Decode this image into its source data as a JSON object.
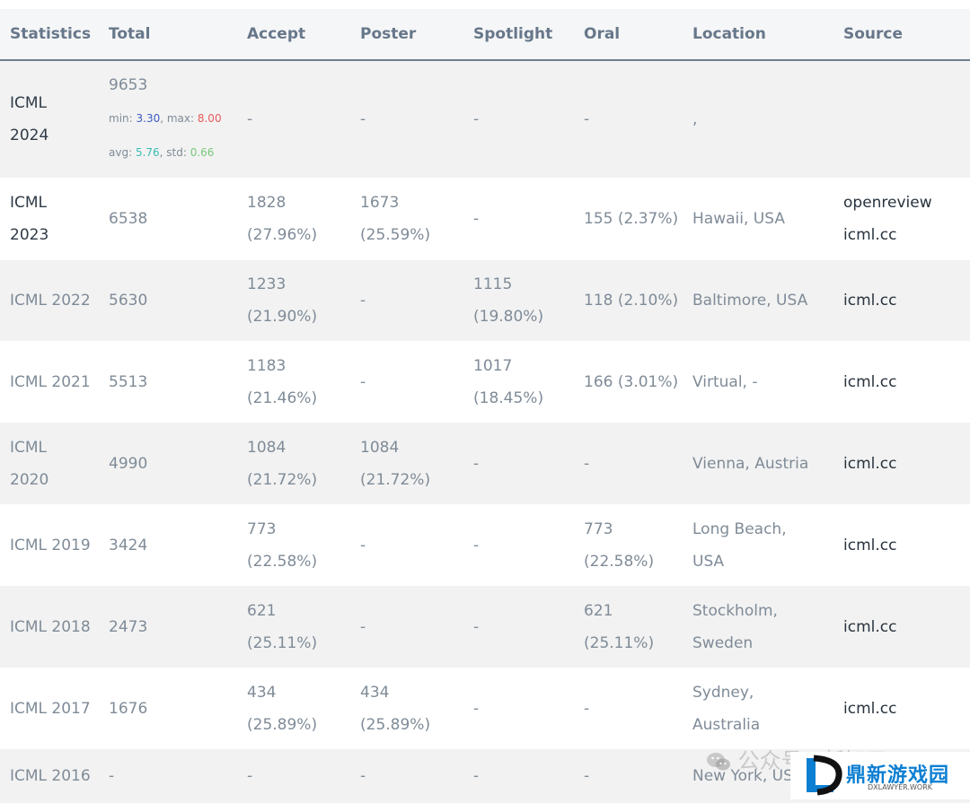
{
  "table": {
    "headers": [
      "Statistics",
      "Total",
      "Accept",
      "Poster",
      "Spotlight",
      "Oral",
      "Location",
      "Source"
    ],
    "rows": [
      {
        "stat": [
          "ICML",
          "2024"
        ],
        "total": "9653",
        "min_label": "min: ",
        "min": "3.30",
        "max_label": ", max: ",
        "max": "8.00",
        "avg_label": "avg: ",
        "avg": "5.76",
        "std_label": ", std: ",
        "std": "0.66",
        "accept": [
          "-"
        ],
        "poster": [
          "-"
        ],
        "spotlight": [
          "-"
        ],
        "oral": [
          "-"
        ],
        "location": [
          ","
        ],
        "source": [
          ""
        ]
      },
      {
        "stat": [
          "ICML",
          "2023"
        ],
        "total": "6538",
        "accept": [
          "1828",
          "(27.96%)"
        ],
        "poster": [
          "1673",
          "(25.59%)"
        ],
        "spotlight": [
          "-"
        ],
        "oral": [
          "155 (2.37%)"
        ],
        "location": [
          "Hawaii, USA"
        ],
        "source": [
          "openreview",
          "icml.cc"
        ]
      },
      {
        "stat": [
          "ICML 2022"
        ],
        "total": "5630",
        "accept": [
          "1233",
          "(21.90%)"
        ],
        "poster": [
          "-"
        ],
        "spotlight": [
          "1115",
          "(19.80%)"
        ],
        "oral": [
          "118 (2.10%)"
        ],
        "location": [
          "Baltimore, USA"
        ],
        "source": [
          "icml.cc"
        ]
      },
      {
        "stat": [
          "ICML 2021"
        ],
        "total": "5513",
        "accept": [
          "1183",
          "(21.46%)"
        ],
        "poster": [
          "-"
        ],
        "spotlight": [
          "1017",
          "(18.45%)"
        ],
        "oral": [
          "166 (3.01%)"
        ],
        "location": [
          "Virtual, -"
        ],
        "source": [
          "icml.cc"
        ]
      },
      {
        "stat": [
          "ICML",
          "2020"
        ],
        "total": "4990",
        "accept": [
          "1084",
          "(21.72%)"
        ],
        "poster": [
          "1084",
          "(21.72%)"
        ],
        "spotlight": [
          "-"
        ],
        "oral": [
          "-"
        ],
        "location": [
          "Vienna, Austria"
        ],
        "source": [
          "icml.cc"
        ]
      },
      {
        "stat": [
          "ICML 2019"
        ],
        "total": "3424",
        "accept": [
          "773",
          "(22.58%)"
        ],
        "poster": [
          "-"
        ],
        "spotlight": [
          "-"
        ],
        "oral": [
          "773",
          "(22.58%)"
        ],
        "location": [
          "Long Beach,",
          "USA"
        ],
        "source": [
          "icml.cc"
        ]
      },
      {
        "stat": [
          "ICML 2018"
        ],
        "total": "2473",
        "accept": [
          "621 (25.11%)"
        ],
        "poster": [
          "-"
        ],
        "spotlight": [
          "-"
        ],
        "oral": [
          "621",
          "(25.11%)"
        ],
        "location": [
          "Stockholm,",
          "Sweden"
        ],
        "source": [
          "icml.cc"
        ]
      },
      {
        "stat": [
          "ICML 2017"
        ],
        "total": "1676",
        "accept": [
          "434",
          "(25.89%)"
        ],
        "poster": [
          "434",
          "(25.89%)"
        ],
        "spotlight": [
          "-"
        ],
        "oral": [
          "-"
        ],
        "location": [
          "Sydney,",
          "Australia"
        ],
        "source": [
          "icml.cc"
        ]
      },
      {
        "stat": [
          "ICML 2016"
        ],
        "total": "-",
        "accept": [
          "-"
        ],
        "poster": [
          "-"
        ],
        "spotlight": [
          "-"
        ],
        "oral": [
          "-"
        ],
        "location": [
          "New York, US"
        ],
        "source": [
          ""
        ]
      }
    ]
  },
  "watermark": {
    "text": "公众号 · 新智元",
    "icon": "wechat-icon"
  },
  "site_logo": {
    "title": "鼎新游戏园",
    "subtitle": "DXLAWYER.WORK",
    "icon": "dx-logo-icon"
  },
  "colors": {
    "header_text": "#67778a",
    "header_rule": "#6d7d8b",
    "stripe": "#f2f2f2",
    "min_value": "#3b5cc4",
    "max_value": "#e85a5a",
    "avg_value": "#3bbcb6",
    "std_value": "#79c77c",
    "logo_blue": "#0d7fd2"
  }
}
